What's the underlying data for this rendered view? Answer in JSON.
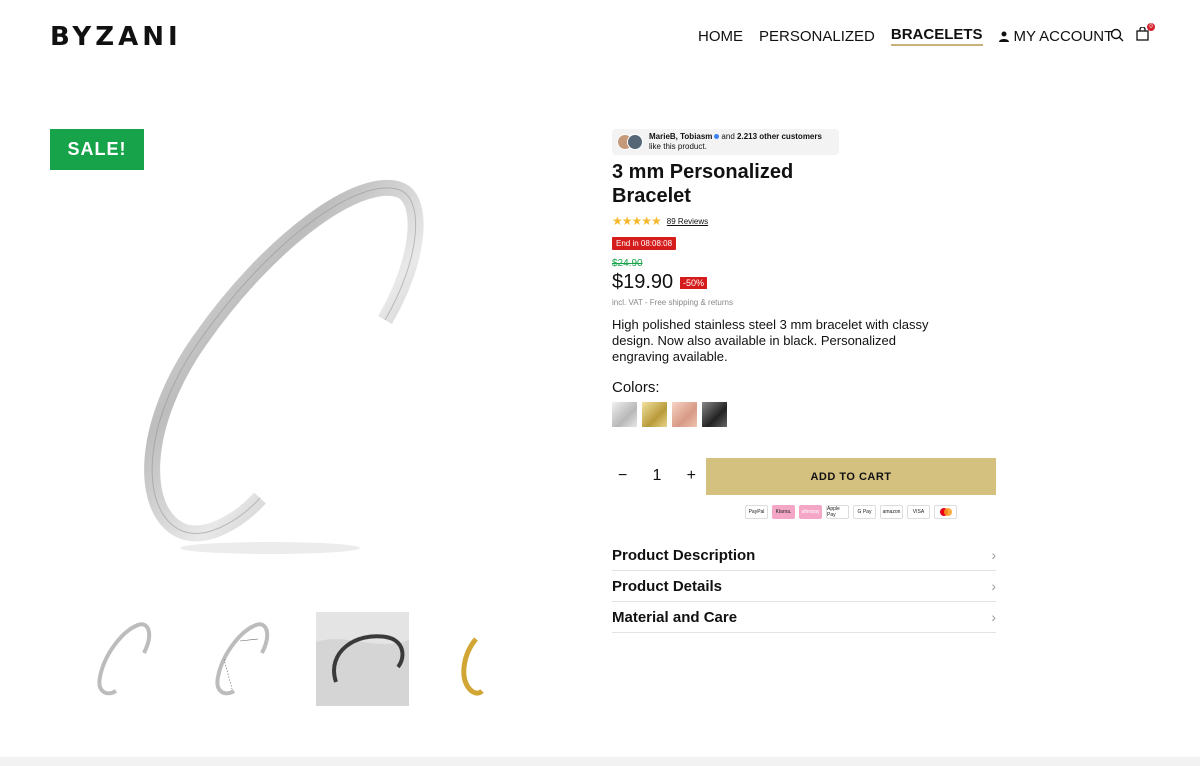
{
  "brand": {
    "logo": "BYZANI"
  },
  "nav": {
    "items": [
      "HOME",
      "PERSONALIZED",
      "BRACELETS"
    ],
    "account": "MY ACCOUNT",
    "cart_count": "0"
  },
  "gallery": {
    "sale_badge": "SALE!",
    "thumbnails": [
      "silver bracelet",
      "dimension diagram",
      "bracelet on fabric",
      "gold bracelet"
    ],
    "selected_thumbnail": 2
  },
  "social_proof": {
    "names": "MarieB, Tobiasm",
    "and_text": "and",
    "count": "2.213 other customers",
    "line2": "like this product."
  },
  "product": {
    "title": "3 mm Personalized Bracelet",
    "stars": "★★★★★",
    "reviews": "89 Reviews",
    "timer": "End in 08:08:08",
    "old_price": "$24.90",
    "price": "$19.90",
    "discount": "-50%",
    "vat_note": "incl. VAT - Free shipping & returns",
    "description": "High polished stainless steel 3 mm bracelet with classy design. Now also available in black. Personalized engraving available.",
    "colors_label": "Colors:",
    "colors": [
      {
        "name": "Silver",
        "hex": "#c8c8c8"
      },
      {
        "name": "Gold",
        "hex": "#c9a94a"
      },
      {
        "name": "Rose Gold",
        "hex": "#e0a891"
      },
      {
        "name": "Black",
        "hex": "#333333"
      }
    ]
  },
  "purchase": {
    "minus": "−",
    "quantity": "1",
    "plus": "+",
    "add_to_cart": "ADD TO CART",
    "accent": "#d4c17f"
  },
  "payments": [
    "PayPal",
    "Klarna.",
    "afterpay",
    "Apple Pay",
    "G Pay",
    "amazon",
    "VISA",
    "mastercard"
  ],
  "accordion": [
    {
      "label": "Product Description"
    },
    {
      "label": "Product Details"
    },
    {
      "label": "Material and Care"
    }
  ],
  "colors": {
    "sale_green": "#16a34a",
    "sale_red": "#d41c1c",
    "gold_accent": "#d4c17f"
  }
}
